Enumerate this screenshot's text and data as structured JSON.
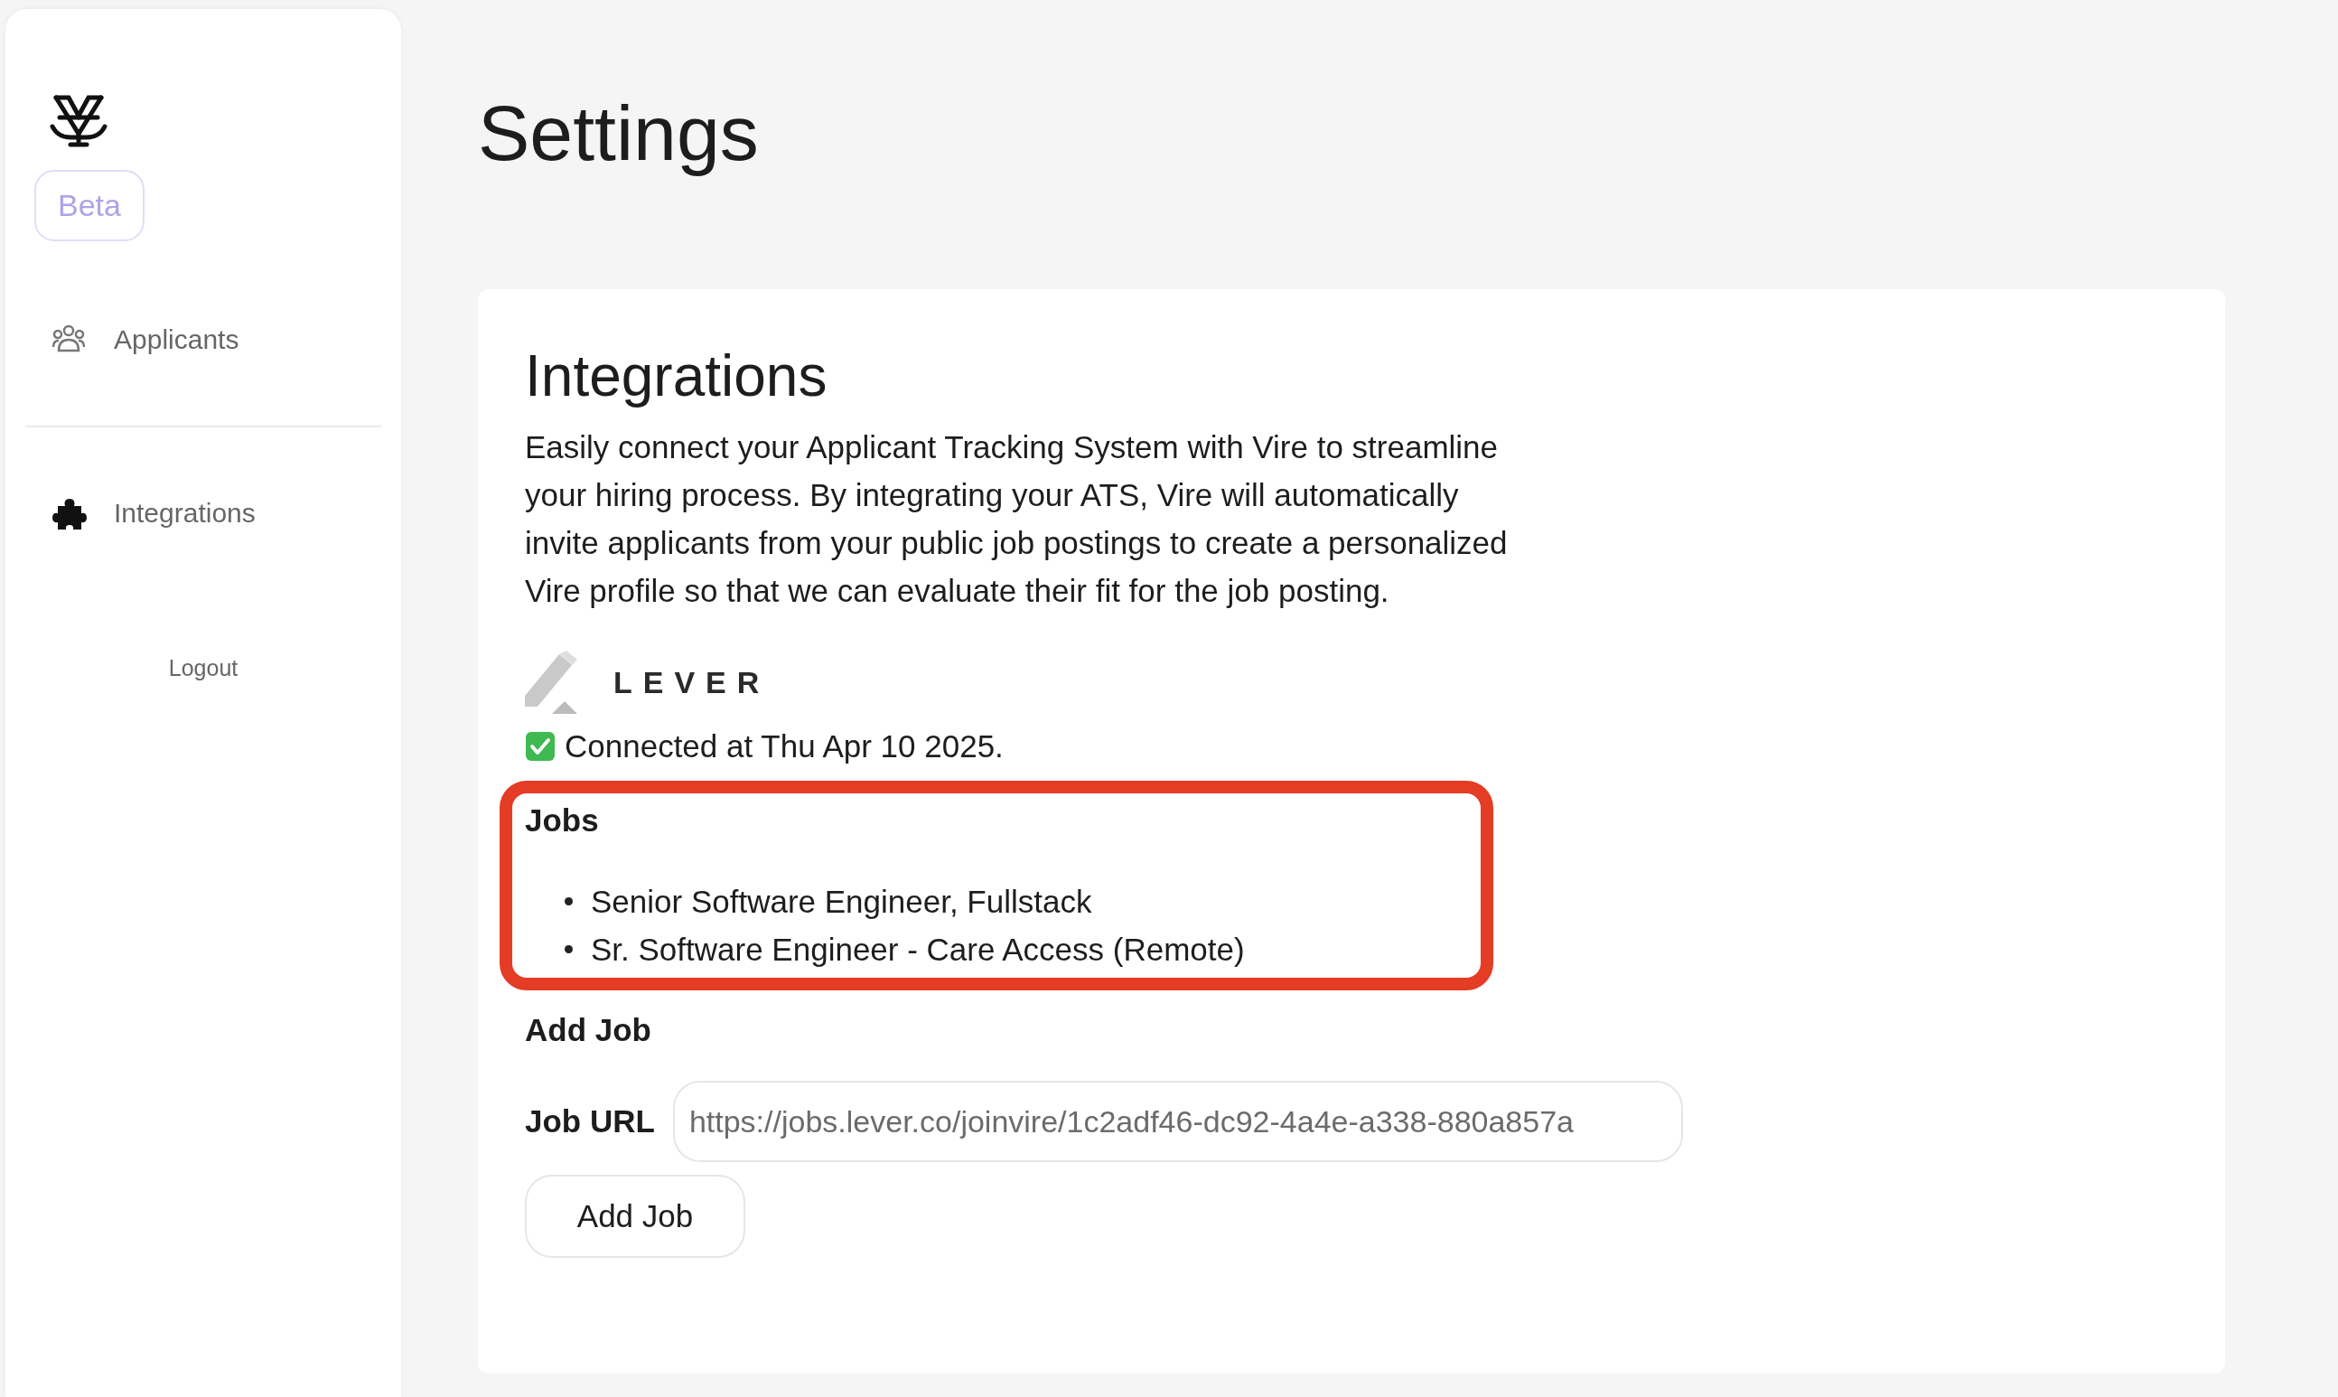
{
  "sidebar": {
    "badge": "Beta",
    "items": [
      {
        "label": "Applicants",
        "kind": "people",
        "selected": false
      },
      {
        "label": "Integrations",
        "kind": "puzzle",
        "selected": true
      }
    ],
    "logout": "Logout"
  },
  "page_title": "Settings",
  "integrations": {
    "title": "Integrations",
    "description": "Easily connect your Applicant Tracking System with Vire to streamline your hiring process. By integrating your ATS, Vire will automatically invite applicants from your public job postings to create a personalized Vire profile so that we can evaluate their fit for the job posting.",
    "provider": "LEVER",
    "status": "Connected at Thu Apr 10 2025.",
    "jobs_heading": "Jobs",
    "jobs": [
      "Senior Software Engineer, Fullstack",
      "Sr. Software Engineer - Care Access (Remote)"
    ],
    "add_heading": "Add Job",
    "url_label": "Job URL",
    "url_value": "https://jobs.lever.co/joinvire/1c2adf46-dc92-4a4e-a338-880a857a",
    "add_button": "Add Job"
  }
}
